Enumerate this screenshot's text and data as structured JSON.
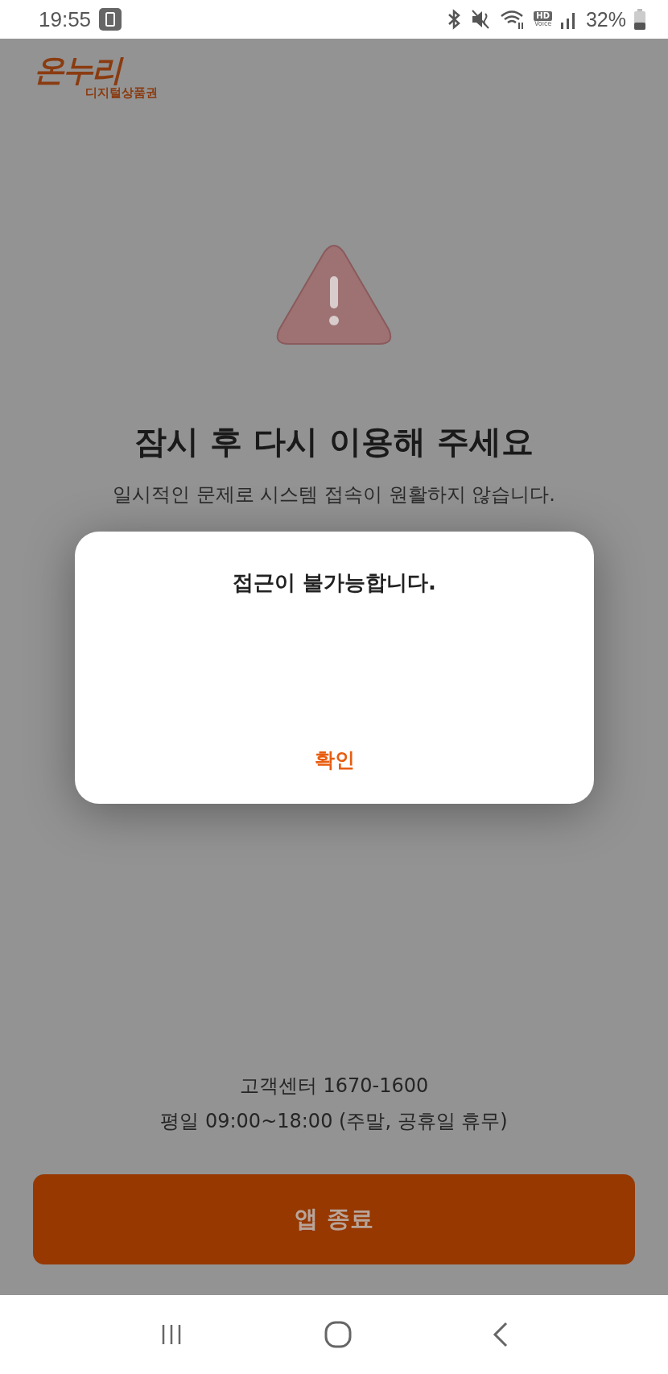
{
  "status_bar": {
    "time": "19:55",
    "hd_top": "HD",
    "hd_bottom": "Voice",
    "battery": "32%"
  },
  "logo": {
    "name": "온누리",
    "subtitle": "디지털상품권"
  },
  "error": {
    "title": "잠시 후 다시 이용해 주세요",
    "message": "일시적인 문제로 시스템 접속이 원활하지 않습니다."
  },
  "dialog": {
    "message": "접근이 불가능합니다.",
    "button": "확인"
  },
  "support": {
    "phone": "고객센터 1670-1600",
    "hours": "평일 09:00~18:00 (주말, 공휴일 휴무)"
  },
  "exit_button": "앱 종료"
}
